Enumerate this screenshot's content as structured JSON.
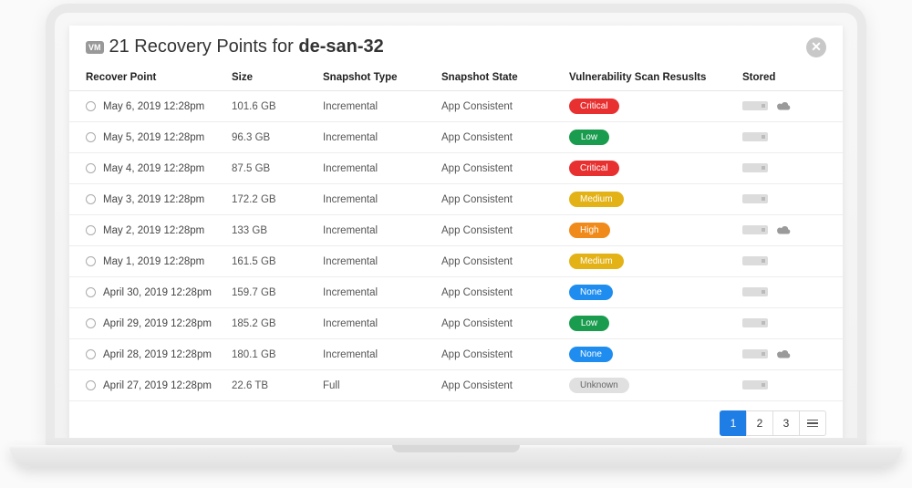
{
  "header": {
    "vm_tag": "VM",
    "title_prefix": "21 Recovery Points for ",
    "title_strong": "de-san-32"
  },
  "columns": {
    "recover_point": "Recover Point",
    "size": "Size",
    "snapshot_type": "Snapshot Type",
    "snapshot_state": "Snapshot State",
    "vuln": "Vulnerability Scan Resuslts",
    "stored": "Stored"
  },
  "rows": [
    {
      "date": "May 6, 2019  12:28pm",
      "size": "101.6 GB",
      "type": "Incremental",
      "state": "App Consistent",
      "vuln": "Critical",
      "cloud": true
    },
    {
      "date": "May 5, 2019  12:28pm",
      "size": "96.3 GB",
      "type": "Incremental",
      "state": "App Consistent",
      "vuln": "Low",
      "cloud": false
    },
    {
      "date": "May 4, 2019  12:28pm",
      "size": "87.5 GB",
      "type": "Incremental",
      "state": "App Consistent",
      "vuln": "Critical",
      "cloud": false
    },
    {
      "date": "May 3, 2019  12:28pm",
      "size": "172.2 GB",
      "type": "Incremental",
      "state": "App Consistent",
      "vuln": "Medium",
      "cloud": false
    },
    {
      "date": "May 2, 2019  12:28pm",
      "size": "133 GB",
      "type": "Incremental",
      "state": "App Consistent",
      "vuln": "High",
      "cloud": true
    },
    {
      "date": "May 1, 2019  12:28pm",
      "size": "161.5 GB",
      "type": "Incremental",
      "state": "App Consistent",
      "vuln": "Medium",
      "cloud": false
    },
    {
      "date": "April 30, 2019  12:28pm",
      "size": "159.7 GB",
      "type": "Incremental",
      "state": "App Consistent",
      "vuln": "None",
      "cloud": false
    },
    {
      "date": "April 29, 2019  12:28pm",
      "size": "185.2 GB",
      "type": "Incremental",
      "state": "App Consistent",
      "vuln": "Low",
      "cloud": false
    },
    {
      "date": "April 28, 2019  12:28pm",
      "size": "180.1 GB",
      "type": "Incremental",
      "state": "App Consistent",
      "vuln": "None",
      "cloud": true
    },
    {
      "date": "April 27, 2019  12:28pm",
      "size": "22.6 TB",
      "type": "Full",
      "state": "App Consistent",
      "vuln": "Unknown",
      "cloud": false
    }
  ],
  "pager": {
    "pages": [
      "1",
      "2",
      "3"
    ],
    "active": 0
  }
}
